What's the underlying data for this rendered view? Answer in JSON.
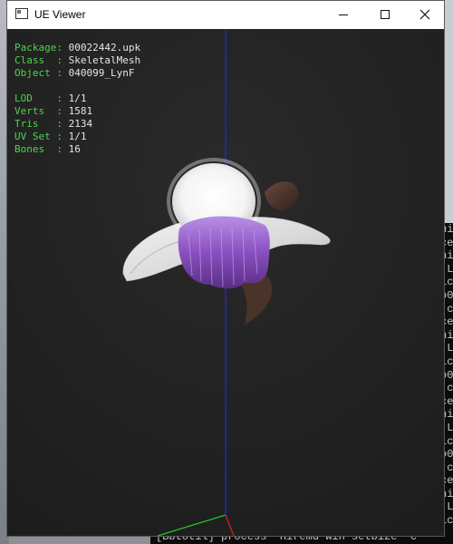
{
  "window": {
    "title": "UE Viewer",
    "icon": "app-window-icon"
  },
  "controls": {
    "minimize": "minimize",
    "maximize": "maximize",
    "close": "close"
  },
  "info": {
    "package_key": "Package:",
    "package_val": "00022442.upk",
    "class_key": "Class  :",
    "class_val": "SkeletalMesh",
    "object_key": "Object :",
    "object_val": "040099_LynF",
    "lod_key": "LOD    :",
    "lod_val": "1/1",
    "verts_key": "Verts  :",
    "verts_val": "1581",
    "tris_key": "Tris   :",
    "tris_val": "2134",
    "uvset_key": "UV Set :",
    "uvset_val": "1/1",
    "bones_key": "Bones  :",
    "bones_val": "16"
  },
  "console": {
    "bottom_line": "[Bbtotil] process  Hiremd win setbize  c"
  },
  "colors": {
    "viewport_bg": "#222222",
    "label_green": "#4bd64b",
    "value_text": "#e6e6e6",
    "axis_blue": "#1e2cc9",
    "axis_red": "#d02020",
    "axis_green": "#22c22a",
    "hair_purple": "#8a4fc0",
    "hat_white": "#ececec"
  }
}
